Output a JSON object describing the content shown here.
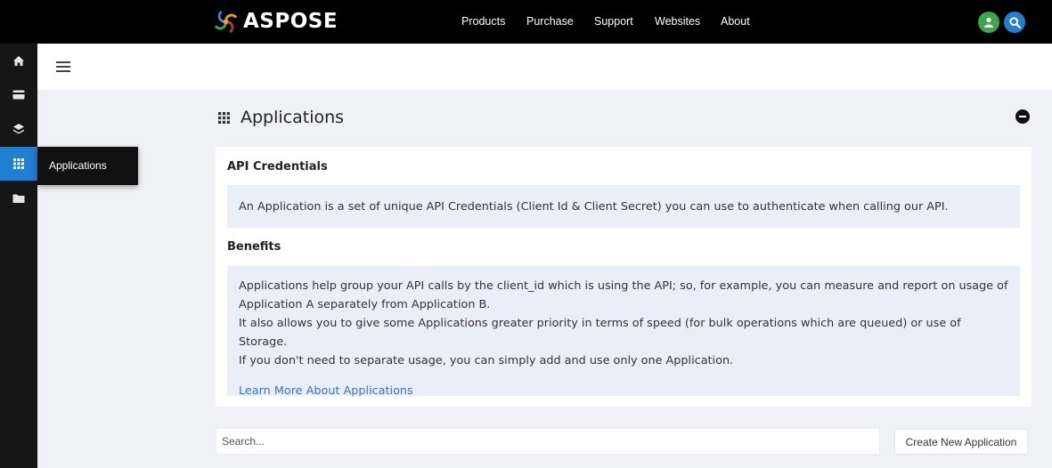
{
  "header": {
    "brand": "ASPOSE",
    "nav": [
      "Products",
      "Purchase",
      "Support",
      "Websites",
      "About"
    ],
    "icons": [
      "user-icon",
      "search-icon"
    ]
  },
  "sidebar": {
    "items": [
      {
        "icon": "home-icon"
      },
      {
        "icon": "card-icon"
      },
      {
        "icon": "layers-icon"
      },
      {
        "icon": "grid-icon",
        "active": true
      },
      {
        "icon": "folder-icon"
      }
    ],
    "tooltip": "Applications"
  },
  "page": {
    "title": "Applications"
  },
  "card": {
    "credentials_title": "API Credentials",
    "credentials_text": "An Application is a set of unique API Credentials (Client Id & Client Secret) you can use to authenticate when calling our API.",
    "benefits_title": "Benefits",
    "benefits_lines": [
      "Applications help group your API calls by the client_id which is using the API; so, for example, you can measure and report on usage of Application A separately from Application B.",
      "It also allows you to give some Applications greater priority in terms of speed (for bulk operations which are queued) or use of Storage.",
      "If you don't need to separate usage, you can simply add and use only one Application."
    ],
    "learn_more": "Learn More About Applications"
  },
  "toolbar": {
    "search_placeholder": "Search...",
    "create_label": "Create New Application"
  },
  "colors": {
    "topbar": "#000000",
    "sidebar": "#161616",
    "accent": "#1f7fd1",
    "user_button": "#3da54a",
    "info_box": "#eaeef8",
    "link": "#3b73c9"
  }
}
